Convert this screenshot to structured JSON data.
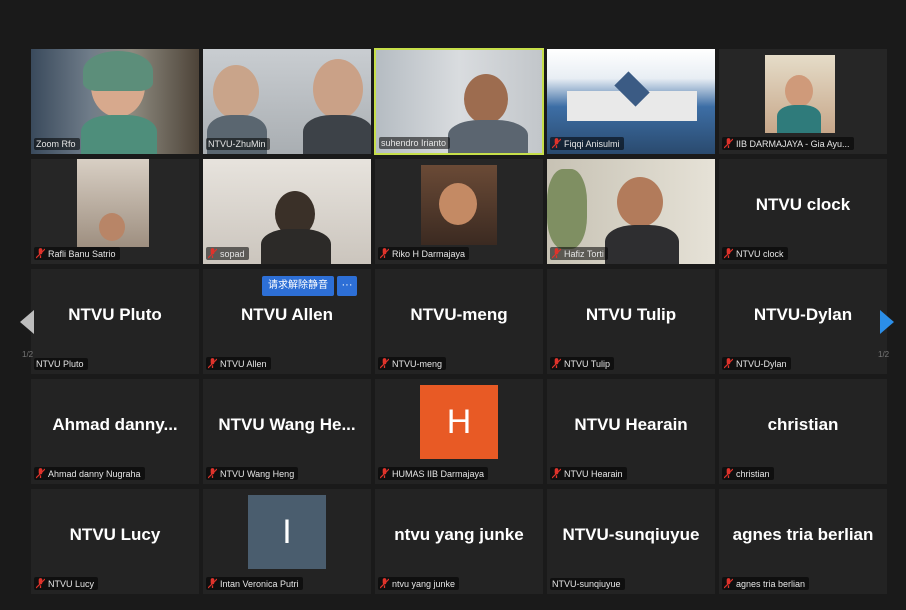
{
  "participants": [
    {
      "name": "Zoom Rfo"
    },
    {
      "name": "NTVU-ZhuMin"
    },
    {
      "name": "suhendro Irianto"
    },
    {
      "name": "Fiqqi Anisulmi"
    },
    {
      "name": "IIB DARMAJAYA - Gia Ayu..."
    },
    {
      "name": "Rafli Banu Satrio"
    },
    {
      "name": "sopad"
    },
    {
      "name": "Riko H Darmajaya"
    },
    {
      "name": "Hafiz Torti"
    },
    {
      "name": "NTVU clock",
      "display": "NTVU clock"
    },
    {
      "name": "NTVU Pluto",
      "display": "NTVU Pluto"
    },
    {
      "name": "NTVU Allen",
      "display": "NTVU Allen"
    },
    {
      "name": "NTVU-meng",
      "display": "NTVU-meng"
    },
    {
      "name": "NTVU Tulip",
      "display": "NTVU Tulip"
    },
    {
      "name": "NTVU-Dylan",
      "display": "NTVU-Dylan"
    },
    {
      "name": "Ahmad danny Nugraha",
      "display": "Ahmad  danny..."
    },
    {
      "name": "NTVU Wang Heng",
      "display": "NTVU  Wang  He..."
    },
    {
      "name": "HUMAS IIB Darmajaya",
      "avatar_letter": "H",
      "avatar_color": "#e85a25"
    },
    {
      "name": "NTVU Hearain",
      "display": "NTVU Hearain"
    },
    {
      "name": "christian",
      "display": "christian"
    },
    {
      "name": "NTVU Lucy",
      "display": "NTVU Lucy"
    },
    {
      "name": "Intan Veronica Putri",
      "avatar_letter": "I",
      "avatar_color": "#4a5d6e"
    },
    {
      "name": "ntvu yang junke",
      "display": "ntvu yang junke"
    },
    {
      "name": "NTVU-sunqiuyue",
      "display": "NTVU-sunqiuyue"
    },
    {
      "name": "agnes tria berlian",
      "display": "agnes tria berlian"
    }
  ],
  "overlay": {
    "unmute_label": "请求解除静音",
    "more_label": "···"
  },
  "pagination": {
    "left_page": "1/2",
    "right_page": "1/2"
  },
  "colors": {
    "active_speaker": "#c7df4a",
    "nav_arrow_right": "#2b8ee8",
    "nav_arrow_left": "#bdbdbd",
    "muted_mic": "#e0332b"
  },
  "icons": {
    "muted": "mic-muted-icon",
    "prev": "chevron-left-icon",
    "next": "chevron-right-icon"
  }
}
